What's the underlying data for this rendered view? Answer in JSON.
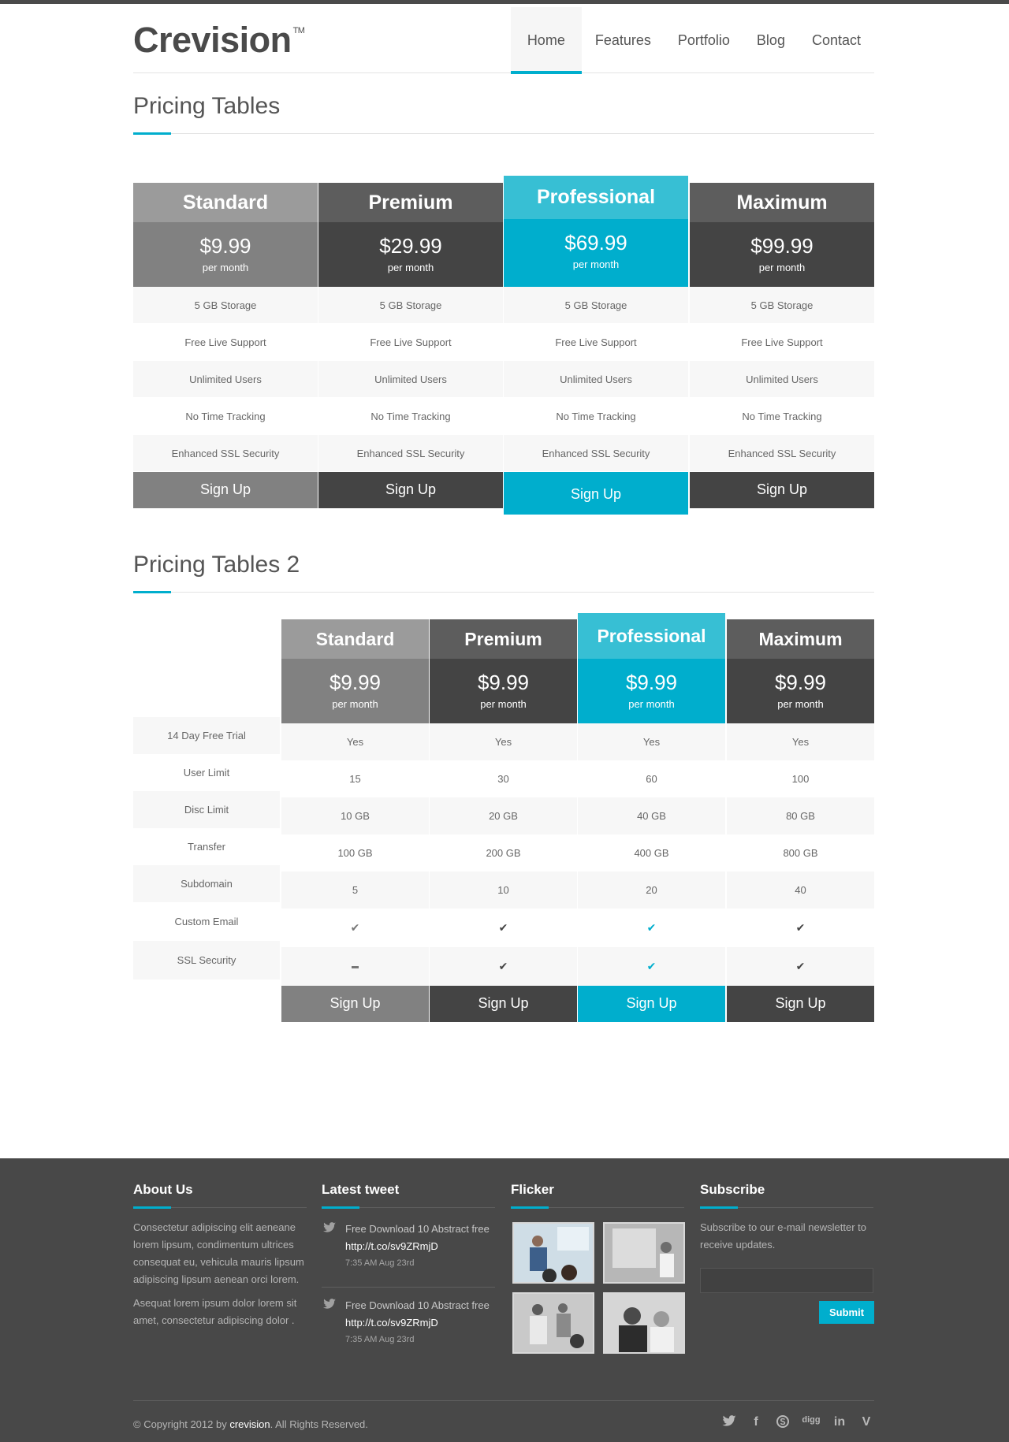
{
  "brand": {
    "name": "Crevision",
    "tm": "TM"
  },
  "nav": [
    {
      "label": "Home",
      "active": true
    },
    {
      "label": "Features"
    },
    {
      "label": "Portfolio"
    },
    {
      "label": "Blog"
    },
    {
      "label": "Contact"
    }
  ],
  "section1": {
    "title": "Pricing Tables",
    "plans": [
      {
        "name": "Standard",
        "price": "$9.99",
        "period": "per month",
        "cta": "Sign Up"
      },
      {
        "name": "Premium",
        "price": "$29.99",
        "period": "per month",
        "cta": "Sign Up"
      },
      {
        "name": "Professional",
        "price": "$69.99",
        "period": "per month",
        "cta": "Sign Up"
      },
      {
        "name": "Maximum",
        "price": "$99.99",
        "period": "per month",
        "cta": "Sign Up"
      }
    ],
    "features": [
      "5 GB Storage",
      "Free Live Support",
      "Unlimited Users",
      "No Time Tracking",
      "Enhanced SSL Security"
    ]
  },
  "section2": {
    "title": "Pricing Tables 2",
    "plans": [
      {
        "name": "Standard",
        "price": "$9.99",
        "period": "per month",
        "cta": "Sign Up"
      },
      {
        "name": "Premium",
        "price": "$9.99",
        "period": "per month",
        "cta": "Sign Up"
      },
      {
        "name": "Professional",
        "price": "$9.99",
        "period": "per month",
        "cta": "Sign Up"
      },
      {
        "name": "Maximum",
        "price": "$9.99",
        "period": "per month",
        "cta": "Sign Up"
      }
    ],
    "row_labels": [
      "14 Day Free Trial",
      "User Limit",
      "Disc Limit",
      "Transfer",
      "Subdomain",
      "Custom Email",
      "SSL Security"
    ],
    "values": [
      [
        "Yes",
        "15",
        "10 GB",
        "100 GB",
        "5"
      ],
      [
        "Yes",
        "30",
        "20 GB",
        "200 GB",
        "10"
      ],
      [
        "Yes",
        "60",
        "40 GB",
        "400 GB",
        "20"
      ],
      [
        "Yes",
        "100",
        "80 GB",
        "800 GB",
        "40"
      ]
    ],
    "icons": {
      "check": "check-icon",
      "dash": "dash-icon"
    }
  },
  "footer": {
    "about": {
      "title": "About Us",
      "p1": "Consectetur adipiscing elit aeneane lorem lipsum, condimentum ultrices consequat eu, vehicula mauris lipsum adipiscing lipsum aenean orci lorem.",
      "p2": "Asequat lorem ipsum dolor lorem sit amet, consectetur adipiscing dolor ."
    },
    "tweets": {
      "title": "Latest tweet",
      "items": [
        {
          "text": "Free Download 10 Abstract free",
          "link": "http://t.co/sv9ZRmjD",
          "date": "7:35 AM Aug 23rd"
        },
        {
          "text": "Free Download 10 Abstract free",
          "link": "http://t.co/sv9ZRmjD",
          "date": "7:35 AM Aug 23rd"
        }
      ]
    },
    "flicker": {
      "title": "Flicker"
    },
    "subscribe": {
      "title": "Subscribe",
      "text": "Subscribe to our e-mail newsletter to receive updates.",
      "button": "Submit"
    },
    "copyright_prefix": "© Copyright 2012 by",
    "copyright_brand": "crevision",
    "copyright_suffix": ". All Rights Reserved.",
    "social": [
      "twitter-icon",
      "facebook-icon",
      "skype-icon",
      "digg-icon",
      "linkedin-icon",
      "vimeo-icon"
    ]
  },
  "colors": {
    "accent": "#00aecd",
    "accent_light": "#37bfd4",
    "dark": "#444444",
    "mid": "#818181",
    "footer_bg": "#484848"
  }
}
